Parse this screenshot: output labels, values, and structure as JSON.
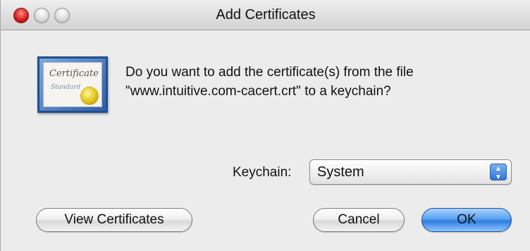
{
  "window": {
    "title": "Add Certificates"
  },
  "icon": {
    "certificate_script": "Certificate",
    "standard_script": "Standard"
  },
  "message": {
    "line1": "Do you want to add the certificate(s) from the file",
    "line2": "\"www.intuitive.com-cacert.crt\" to a keychain?"
  },
  "keychain": {
    "label": "Keychain:",
    "selected": "System"
  },
  "buttons": {
    "view_certificates": "View Certificates",
    "cancel": "Cancel",
    "ok": "OK"
  },
  "colors": {
    "default_button": "#3a8be8",
    "close_button": "#d01a1a"
  }
}
